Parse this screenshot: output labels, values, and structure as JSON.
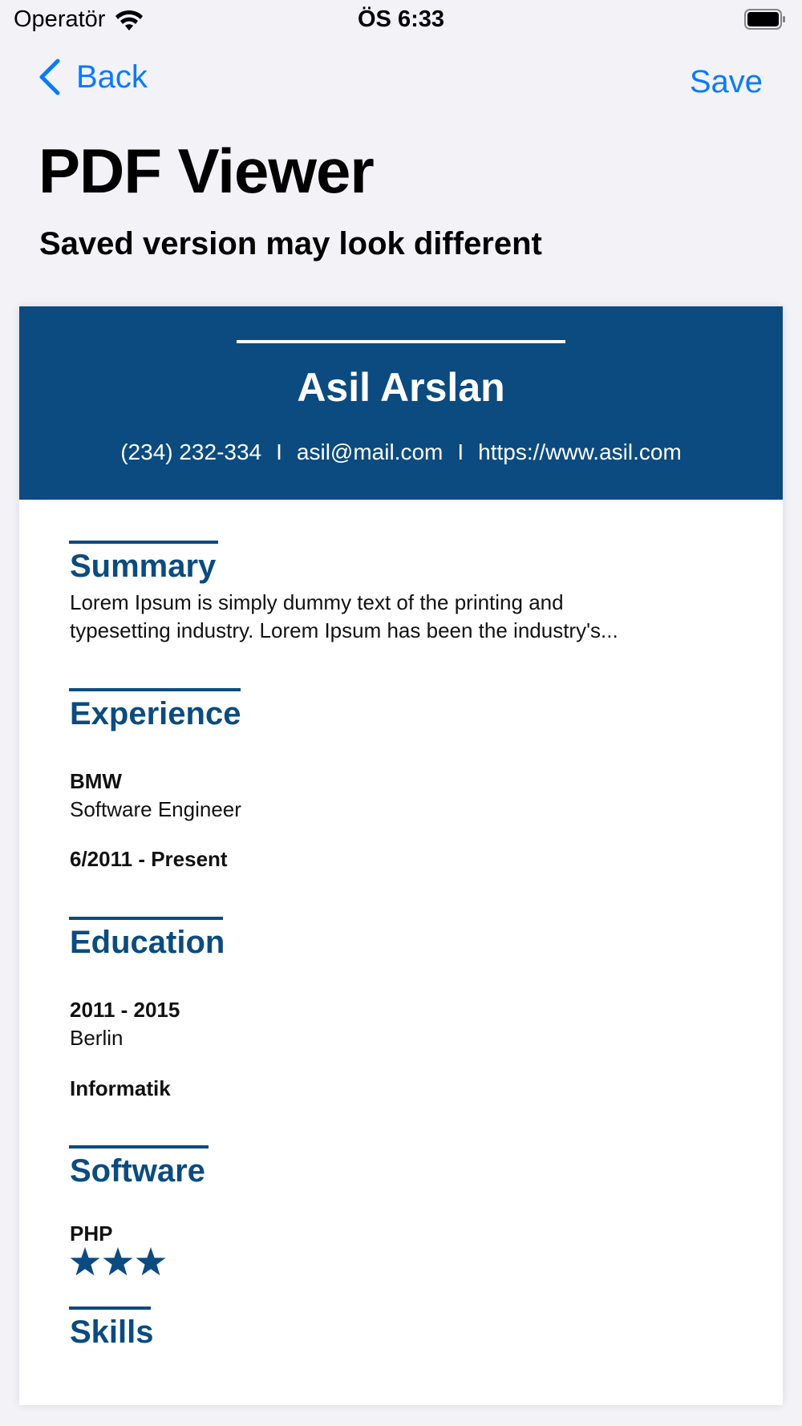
{
  "status_bar": {
    "carrier": "Operatör",
    "time": "ÖS 6:33"
  },
  "nav": {
    "back_label": "Back",
    "save_label": "Save"
  },
  "page": {
    "title": "PDF Viewer",
    "subtitle": "Saved version may look different"
  },
  "resume": {
    "name": "Asil Arslan",
    "phone": "(234) 232-334",
    "email": "asil@mail.com",
    "website": "https://www.asil.com",
    "separator": "I",
    "summary": {
      "title": "Summary",
      "line1": "Lorem Ipsum is simply dummy text of the printing and",
      "line2": "typesetting industry. Lorem Ipsum has been the industry's..."
    },
    "experience": {
      "title": "Experience",
      "company": "BMW",
      "role": "Software Engineer",
      "dates": "6/2011 - Present"
    },
    "education": {
      "title": "Education",
      "years": "2011 - 2015",
      "location": "Berlin",
      "field": "Informatik"
    },
    "software": {
      "title": "Software",
      "name": "PHP",
      "rating": 3
    },
    "skills": {
      "title": "Skills"
    }
  },
  "colors": {
    "accent": "#0a7aff",
    "resume_blue": "#0b4b80",
    "background": "#f2f2f7"
  },
  "icons": [
    "wifi-icon",
    "battery-icon",
    "chevron-left-icon",
    "star-icon"
  ]
}
